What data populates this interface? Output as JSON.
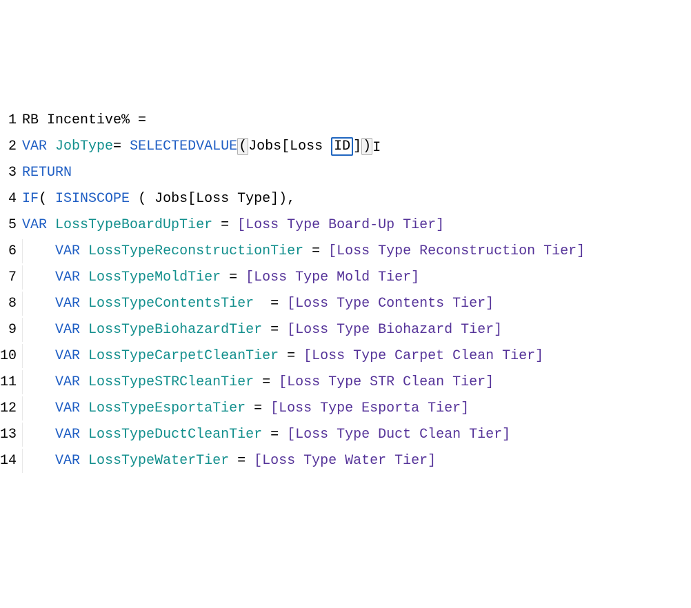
{
  "lines": [
    {
      "num": "1",
      "tokens": [
        {
          "t": "RB Incentive% =",
          "c": "tk-default"
        }
      ]
    },
    {
      "num": "2",
      "tokens": [
        {
          "t": "VAR",
          "c": "tk-keyword"
        },
        {
          "t": " ",
          "c": "tk-default"
        },
        {
          "t": "JobType",
          "c": "tk-identifier"
        },
        {
          "t": "= ",
          "c": "tk-default"
        },
        {
          "t": "SELECTEDVALUE",
          "c": "tk-keyword"
        },
        {
          "t": "(",
          "c": "tk-punct",
          "bracket": "match"
        },
        {
          "t": "Jobs[Loss ",
          "c": "tk-default"
        },
        {
          "t": "ID",
          "c": "tk-default",
          "bracket": "inner"
        },
        {
          "t": "]",
          "c": "tk-punct"
        },
        {
          "t": ")",
          "c": "tk-punct",
          "bracket": "match"
        },
        {
          "t": "",
          "c": "tk-default",
          "cursor": true
        }
      ]
    },
    {
      "num": "3",
      "tokens": [
        {
          "t": "RETURN",
          "c": "tk-keyword"
        }
      ]
    },
    {
      "num": "4",
      "tokens": [
        {
          "t": "IF",
          "c": "tk-keyword"
        },
        {
          "t": "( ",
          "c": "tk-punct"
        },
        {
          "t": "ISINSCOPE",
          "c": "tk-keyword"
        },
        {
          "t": " ( Jobs[Loss Type]),",
          "c": "tk-default"
        }
      ]
    },
    {
      "num": "5",
      "tokens": [
        {
          "t": "VAR",
          "c": "tk-keyword"
        },
        {
          "t": " ",
          "c": "tk-default"
        },
        {
          "t": "LossTypeBoardUpTier",
          "c": "tk-identifier"
        },
        {
          "t": " = ",
          "c": "tk-default"
        },
        {
          "t": "[Loss Type Board-Up Tier]",
          "c": "tk-measure"
        }
      ]
    },
    {
      "num": "6",
      "indent": true,
      "tokens": [
        {
          "t": "VAR",
          "c": "tk-keyword"
        },
        {
          "t": " ",
          "c": "tk-default"
        },
        {
          "t": "LossTypeReconstructionTier",
          "c": "tk-identifier"
        },
        {
          "t": " = ",
          "c": "tk-default"
        },
        {
          "t": "[Loss Type Reconstruction Tier]",
          "c": "tk-measure"
        }
      ]
    },
    {
      "num": "7",
      "indent": true,
      "tokens": [
        {
          "t": "VAR",
          "c": "tk-keyword"
        },
        {
          "t": " ",
          "c": "tk-default"
        },
        {
          "t": "LossTypeMoldTier",
          "c": "tk-identifier"
        },
        {
          "t": " = ",
          "c": "tk-default"
        },
        {
          "t": "[Loss Type Mold Tier]",
          "c": "tk-measure"
        }
      ]
    },
    {
      "num": "8",
      "indent": true,
      "tokens": [
        {
          "t": "VAR",
          "c": "tk-keyword"
        },
        {
          "t": " ",
          "c": "tk-default"
        },
        {
          "t": "LossTypeContentsTier",
          "c": "tk-identifier"
        },
        {
          "t": "  = ",
          "c": "tk-default"
        },
        {
          "t": "[Loss Type Contents Tier]",
          "c": "tk-measure"
        }
      ]
    },
    {
      "num": "9",
      "indent": true,
      "tokens": [
        {
          "t": "VAR",
          "c": "tk-keyword"
        },
        {
          "t": " ",
          "c": "tk-default"
        },
        {
          "t": "LossTypeBiohazardTier",
          "c": "tk-identifier"
        },
        {
          "t": " = ",
          "c": "tk-default"
        },
        {
          "t": "[Loss Type Biohazard Tier]",
          "c": "tk-measure"
        }
      ]
    },
    {
      "num": "10",
      "indent": true,
      "tokens": [
        {
          "t": "VAR",
          "c": "tk-keyword"
        },
        {
          "t": " ",
          "c": "tk-default"
        },
        {
          "t": "LossTypeCarpetCleanTier",
          "c": "tk-identifier"
        },
        {
          "t": " = ",
          "c": "tk-default"
        },
        {
          "t": "[Loss Type Carpet Clean Tier]",
          "c": "tk-measure"
        }
      ]
    },
    {
      "num": "11",
      "indent": true,
      "tokens": [
        {
          "t": "VAR",
          "c": "tk-keyword"
        },
        {
          "t": " ",
          "c": "tk-default"
        },
        {
          "t": "LossTypeSTRCleanTier",
          "c": "tk-identifier"
        },
        {
          "t": " = ",
          "c": "tk-default"
        },
        {
          "t": "[Loss Type STR Clean Tier]",
          "c": "tk-measure"
        }
      ]
    },
    {
      "num": "12",
      "indent": true,
      "tokens": [
        {
          "t": "VAR",
          "c": "tk-keyword"
        },
        {
          "t": " ",
          "c": "tk-default"
        },
        {
          "t": "LossTypeEsportaTier",
          "c": "tk-identifier"
        },
        {
          "t": " = ",
          "c": "tk-default"
        },
        {
          "t": "[Loss Type Esporta Tier]",
          "c": "tk-measure"
        }
      ]
    },
    {
      "num": "13",
      "indent": true,
      "tokens": [
        {
          "t": "VAR",
          "c": "tk-keyword"
        },
        {
          "t": " ",
          "c": "tk-default"
        },
        {
          "t": "LossTypeDuctCleanTier",
          "c": "tk-identifier"
        },
        {
          "t": " = ",
          "c": "tk-default"
        },
        {
          "t": "[Loss Type Duct Clean Tier]",
          "c": "tk-measure"
        }
      ]
    },
    {
      "num": "14",
      "indent": true,
      "tokens": [
        {
          "t": "VAR",
          "c": "tk-keyword"
        },
        {
          "t": " ",
          "c": "tk-default"
        },
        {
          "t": "LossTypeWaterTier",
          "c": "tk-identifier"
        },
        {
          "t": " = ",
          "c": "tk-default"
        },
        {
          "t": "[Loss Type Water Tier]",
          "c": "tk-measure"
        }
      ]
    }
  ]
}
